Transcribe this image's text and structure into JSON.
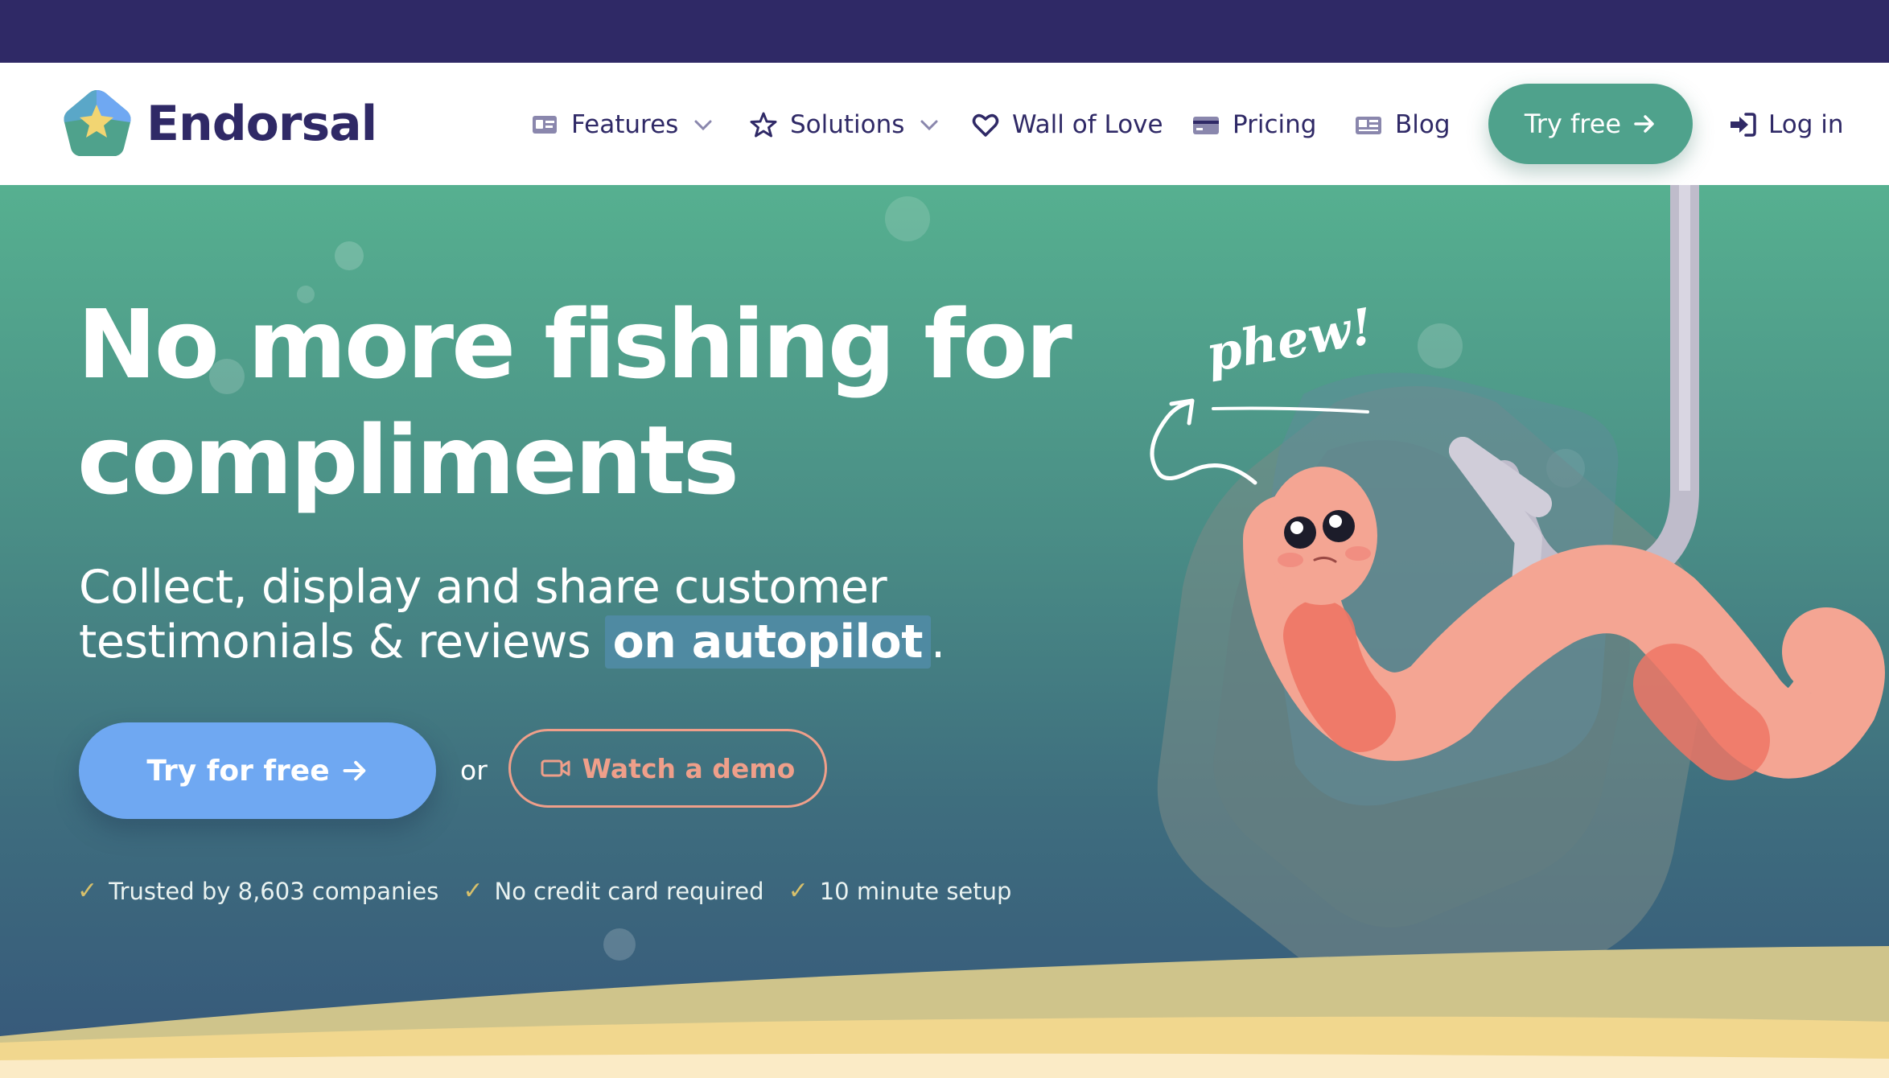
{
  "brand": {
    "name": "Endorsal"
  },
  "nav": {
    "items": [
      {
        "label": "Features",
        "icon": "id-card-icon",
        "dropdown": true
      },
      {
        "label": "Solutions",
        "icon": "star-icon",
        "dropdown": true
      },
      {
        "label": "Wall of Love",
        "icon": "heart-icon",
        "dropdown": false
      },
      {
        "label": "Pricing",
        "icon": "credit-card-icon",
        "dropdown": false
      },
      {
        "label": "Blog",
        "icon": "newspaper-icon",
        "dropdown": false
      }
    ],
    "try_free": "Try free",
    "login": "Log in"
  },
  "hero": {
    "headline_line1": "No more fishing for",
    "headline_line2": "compliments",
    "sub_line1": "Collect, display and share customer",
    "sub_line2_prefix": "testimonials & reviews",
    "sub_highlight": "on autopilot",
    "sub_suffix": ".",
    "cta_primary": "Try for free",
    "or": "or",
    "cta_demo": "Watch a demo",
    "illustration_text": "phew!",
    "checks": [
      "Trusted by 8,603 companies",
      "No credit card required",
      "10 minute setup"
    ]
  },
  "colors": {
    "topbar": "#2f2966",
    "brand_text": "#2f2966",
    "accent_green": "#4fa28c",
    "cta_blue": "#6fa8f2",
    "demo_salmon": "#ef9f8a",
    "check_gold": "#d7c06b",
    "worm_pink": "#f4a593",
    "sand": "#f1d78e"
  }
}
